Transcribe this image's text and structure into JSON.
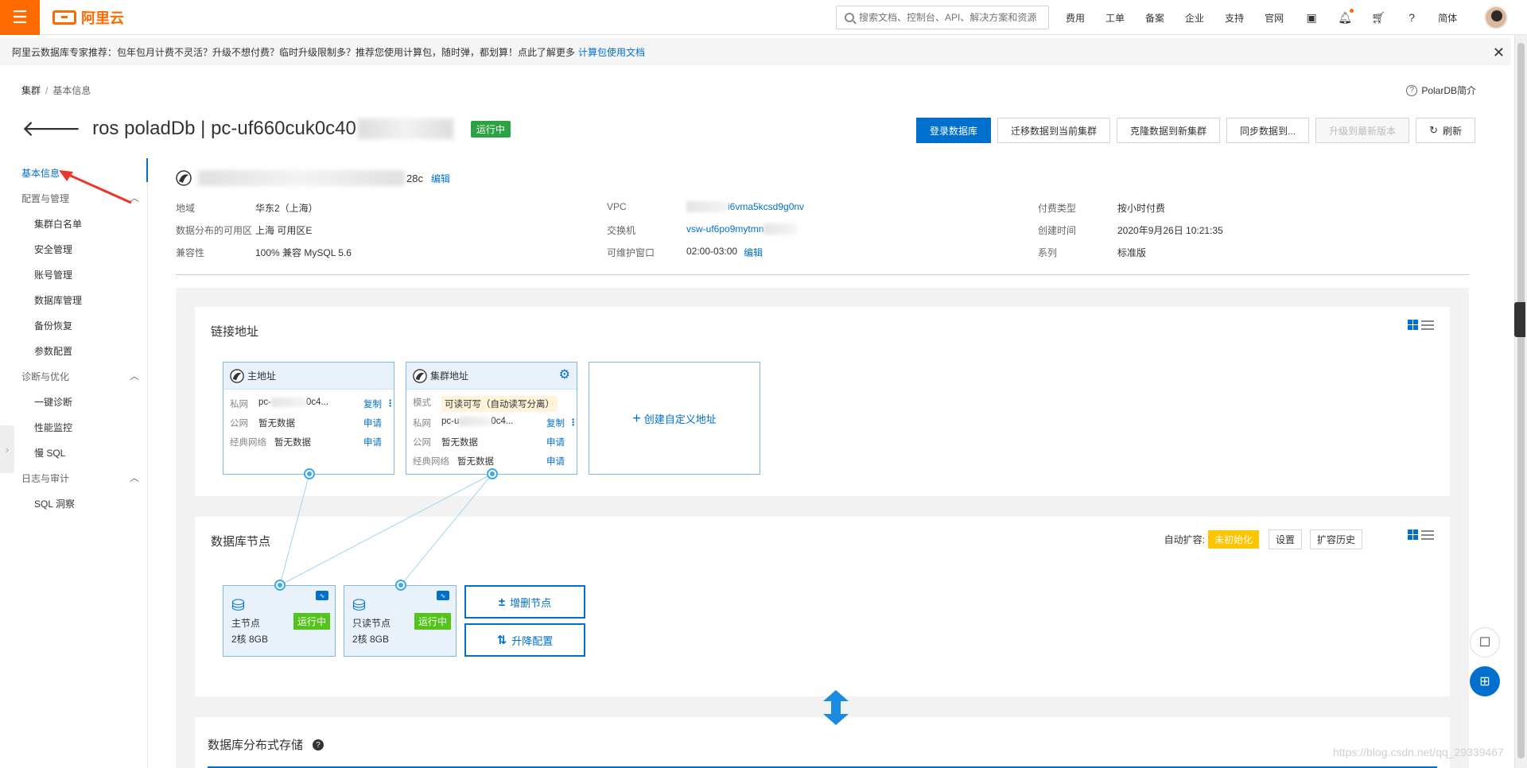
{
  "topbar": {
    "logo_text": "阿里云",
    "search_placeholder": "搜索文档、控制台、API、解决方案和资源",
    "nav": [
      "费用",
      "工单",
      "备案",
      "企业",
      "支持",
      "官网"
    ],
    "lang": "简体",
    "brand_color": "#ff6a00"
  },
  "notice": {
    "text": "阿里云数据库专家推荐：包年包月计费不灵活？升级不想付费？临时升级限制多？推荐您使用计算包，随时弹，都划算！点此了解更多",
    "link": "计算包使用文档"
  },
  "breadcrumb": {
    "root": "集群",
    "sep": "/",
    "current": "基本信息"
  },
  "polar_intro": "PolarDB简介",
  "header": {
    "title": "ros poladDb | pc-uf660cuk0c40",
    "status": "运行中",
    "actions": [
      "登录数据库",
      "迁移数据到当前集群",
      "克隆数据到新集群",
      "同步数据到...",
      "升级到最新版本",
      "刷新"
    ]
  },
  "sidebar": {
    "basic": "基本信息",
    "group1": "配置与管理",
    "items1": [
      "集群白名单",
      "安全管理",
      "账号管理",
      "数据库管理",
      "备份恢复",
      "参数配置"
    ],
    "group2": "诊断与优化",
    "items2": [
      "一键诊断",
      "性能监控",
      "慢 SQL"
    ],
    "group3": "日志与审计",
    "items3": [
      "SQL 洞察"
    ]
  },
  "info": {
    "id_suffix": "28c",
    "edit": "编辑",
    "col1": [
      {
        "k": "地域",
        "v": "华东2（上海）"
      },
      {
        "k": "数据分布的可用区",
        "v": "上海 可用区E"
      },
      {
        "k": "兼容性",
        "v": "100% 兼容 MySQL 5.6"
      }
    ],
    "col2": [
      {
        "k": "VPC",
        "v": "i6vma5kcsd9g0nv"
      },
      {
        "k": "交换机",
        "v": "vsw-uf6po9mytmn"
      },
      {
        "k": "可维护窗口",
        "v": "02:00-03:00"
      }
    ],
    "col3": [
      {
        "k": "付费类型",
        "v": "按小时付费"
      },
      {
        "k": "创建时间",
        "v": "2020年9月26日 10:21:35"
      },
      {
        "k": "系列",
        "v": "标准版"
      }
    ]
  },
  "conn": {
    "title": "链接地址",
    "primary": {
      "title": "主地址",
      "rows": [
        {
          "k": "私网",
          "v": "pc-",
          "v2": "0c4...",
          "act": "复制"
        },
        {
          "k": "公网",
          "v": "暂无数据",
          "act": "申请"
        },
        {
          "k": "经典网络",
          "v": "暂无数据",
          "act": "申请"
        }
      ]
    },
    "cluster": {
      "title": "集群地址",
      "mode_k": "模式",
      "mode_v": "可读可写（自动读写分离）",
      "rows": [
        {
          "k": "私网",
          "v": "pc-u",
          "v2": "0c4...",
          "act": "复制"
        },
        {
          "k": "公网",
          "v": "暂无数据",
          "act": "申请"
        },
        {
          "k": "经典网络",
          "v": "暂无数据",
          "act": "申请"
        }
      ]
    },
    "custom": "创建自定义地址"
  },
  "nodes": {
    "title": "数据库节点",
    "autoscale_label": "自动扩容:",
    "autoscale_status": "未初始化",
    "settings": "设置",
    "history": "扩容历史",
    "primary": {
      "label": "主节点",
      "spec": "2核 8GB",
      "status": "运行中"
    },
    "readonly": {
      "label": "只读节点",
      "spec": "2核 8GB",
      "status": "运行中"
    },
    "add_remove": "增删节点",
    "scale": "升降配置"
  },
  "storage": {
    "title": "数据库分布式存储"
  },
  "watermark": "https://blog.csdn.net/qq_29339467"
}
